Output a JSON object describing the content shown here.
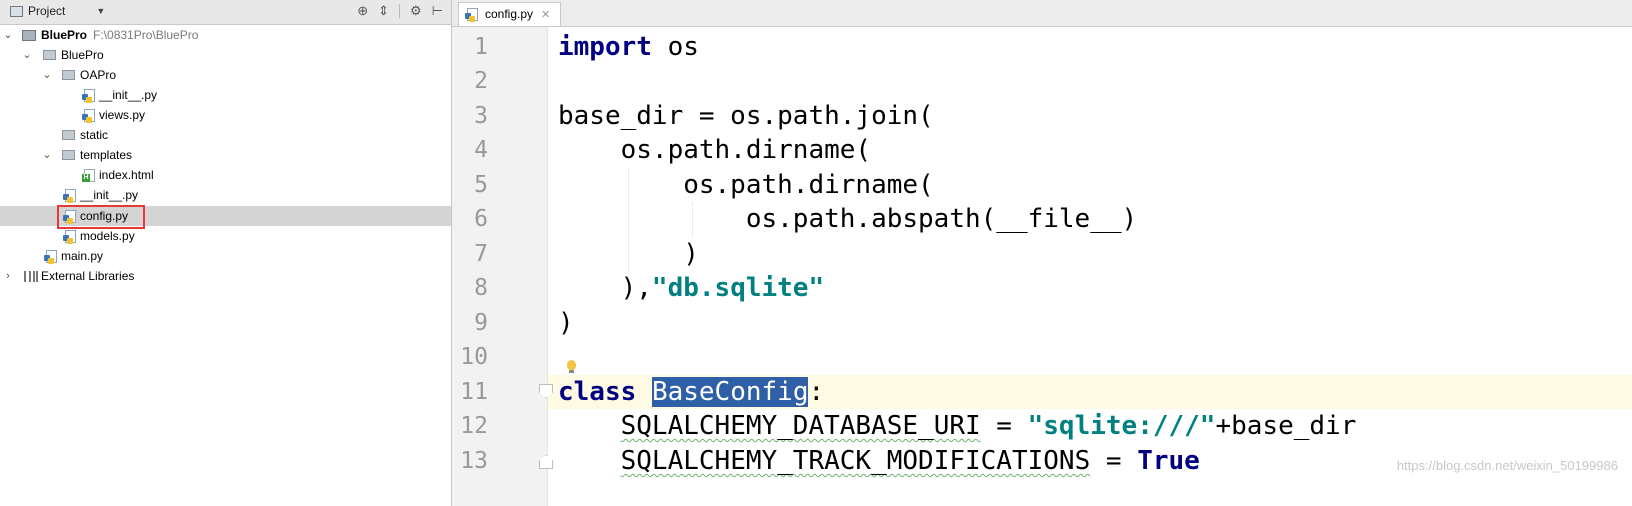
{
  "project_panel": {
    "title": "Project",
    "tree": [
      {
        "label": "BluePro",
        "path": "F:\\0831Pro\\BluePro"
      },
      {
        "label": "BluePro"
      },
      {
        "label": "OAPro"
      },
      {
        "label": "__init__.py"
      },
      {
        "label": "views.py"
      },
      {
        "label": "static"
      },
      {
        "label": "templates"
      },
      {
        "label": "index.html"
      },
      {
        "label": "__init__.py"
      },
      {
        "label": "config.py"
      },
      {
        "label": "models.py"
      },
      {
        "label": "main.py"
      },
      {
        "label": "External Libraries"
      }
    ]
  },
  "editor": {
    "tab_label": "config.py",
    "line_numbers": [
      "1",
      "2",
      "3",
      "4",
      "5",
      "6",
      "7",
      "8",
      "9",
      "10",
      "11",
      "12",
      "13"
    ],
    "code": {
      "l1_kw": "import",
      "l1_rest": " os",
      "l3": "base_dir = os.path.join(",
      "l4": "    os.path.dirname(",
      "l5": "        os.path.dirname(",
      "l6": "            os.path.abspath(__file__)",
      "l7": "        )",
      "l8_pre": "    ),",
      "l8_str": "\"db.sqlite\"",
      "l9": ")",
      "l11_kw": "class",
      "l11_sp": " ",
      "l11_name": "BaseConfig",
      "l11_end": ":",
      "l12_pre": "    ",
      "l12_var": "SQLALCHEMY_DATABASE_URI",
      "l12_eq": " = ",
      "l12_str": "\"sqlite:///\"",
      "l12_end": "+base_dir",
      "l13_pre": "    ",
      "l13_var": "SQLALCHEMY_TRACK_MODIFICATIONS",
      "l13_eq": " = ",
      "l13_kw": "True"
    }
  },
  "watermark": "https://blog.csdn.net/weixin_50199986",
  "colors": {
    "keyword": "#000080",
    "string": "#008080",
    "selection": "#2f5fa7",
    "current_line": "#fffae3",
    "selected_row": "#d4d4d4",
    "highlight_box": "#e53935"
  }
}
